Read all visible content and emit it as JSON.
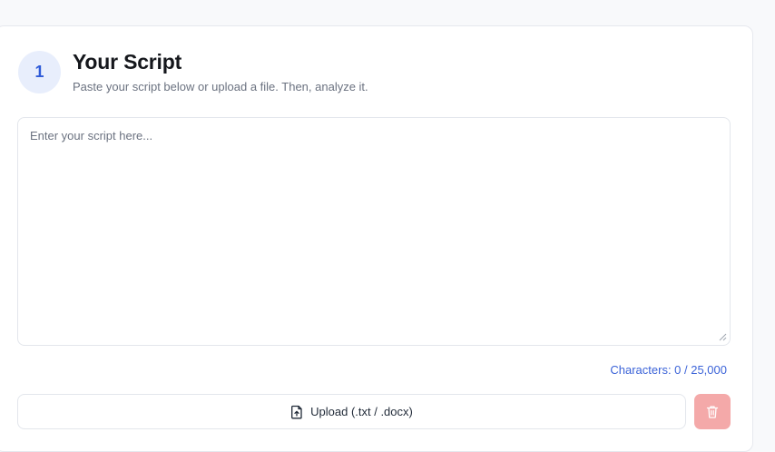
{
  "step": {
    "number": "1",
    "title": "Your Script",
    "subtitle": "Paste your script below or upload a file. Then, analyze it."
  },
  "script_input": {
    "value": "",
    "placeholder": "Enter your script here..."
  },
  "char_counter": "Characters: 0 / 25,000",
  "upload": {
    "label": "Upload (.txt / .docx)",
    "icon": "file-upload-icon"
  },
  "delete": {
    "icon": "trash-icon",
    "color": "#f4a9a9"
  },
  "colors": {
    "accent": "#3b63d8",
    "badge_bg": "#e8eefc"
  }
}
